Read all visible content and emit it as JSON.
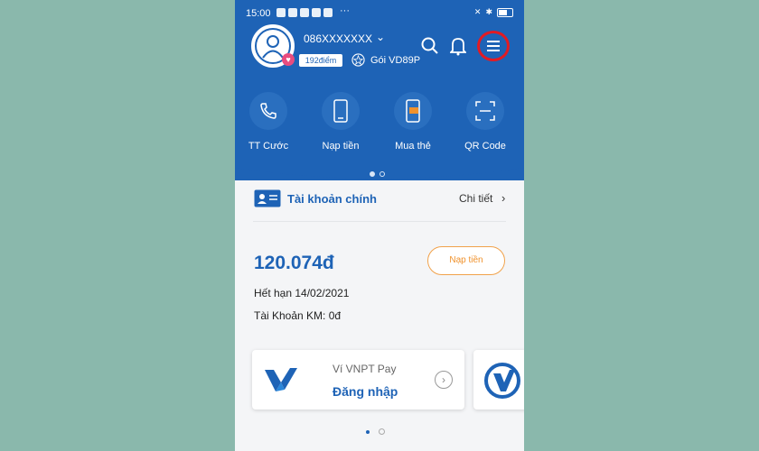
{
  "status_bar": {
    "time": "15:00",
    "more": "···"
  },
  "profile": {
    "phone_number": "086XXXXXXX",
    "points": "192điểm",
    "package": "Gói VD89P"
  },
  "quick_actions": [
    {
      "label": "TT Cước",
      "icon": "phone-bill-icon"
    },
    {
      "label": "Nạp tiền",
      "icon": "mobile-topup-icon"
    },
    {
      "label": "Mua thẻ",
      "icon": "buy-card-icon"
    },
    {
      "label": "QR Code",
      "icon": "qr-code-icon"
    }
  ],
  "account": {
    "title": "Tài khoản chính",
    "detail_label": "Chi tiết",
    "balance": "120.074đ",
    "topup_label": "Nạp tiền",
    "expiry": "Hết hạn 14/02/2021",
    "promo": "Tài Khoản KM: 0đ"
  },
  "wallet_card": {
    "subtitle": "Ví VNPT Pay",
    "action": "Đăng nhập"
  },
  "colors": {
    "primary": "#1e63b6",
    "accent": "#f0922d",
    "highlight": "#e21b23",
    "background": "#8ab8ac"
  }
}
